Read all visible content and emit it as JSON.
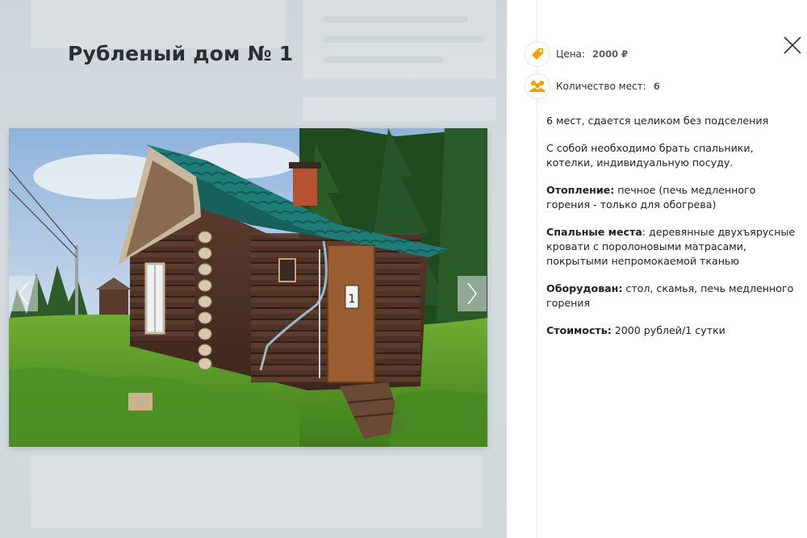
{
  "page": {
    "title": "Рубленый дом № 1"
  },
  "gallery": {
    "prev_icon": "chevron-left-icon",
    "next_icon": "chevron-right-icon",
    "photo_label": "1"
  },
  "details": {
    "close_icon": "close-icon",
    "price": {
      "icon": "price-tag-icon",
      "label": "Цена:",
      "value": "2000 ₽"
    },
    "places": {
      "icon": "people-icon",
      "label": "Количество мест:",
      "value": "6"
    },
    "description": [
      {
        "bold": "",
        "text": "6 мест, сдается целиком без подселения"
      },
      {
        "bold": "",
        "text": "С собой необходимо брать спальники, котелки, индивидуальную посуду."
      },
      {
        "bold": "Отопление:",
        "text": " печное (печь медленного горения - только для обогрева)"
      },
      {
        "bold": "Спальные места",
        "text": ": деревянные двухъярусные кровати с поролоновыми матрасами, покрытыми непромокаемой тканью"
      },
      {
        "bold": "Оборудован:",
        "text": " стол, скамья, печь медленного горения"
      },
      {
        "bold": "Стоимость:",
        "text": " 2000 рублей/1 сутки"
      }
    ]
  },
  "colors": {
    "accent": "#f0a000",
    "overlay": "#d3d9dd",
    "panel": "#ffffff"
  }
}
